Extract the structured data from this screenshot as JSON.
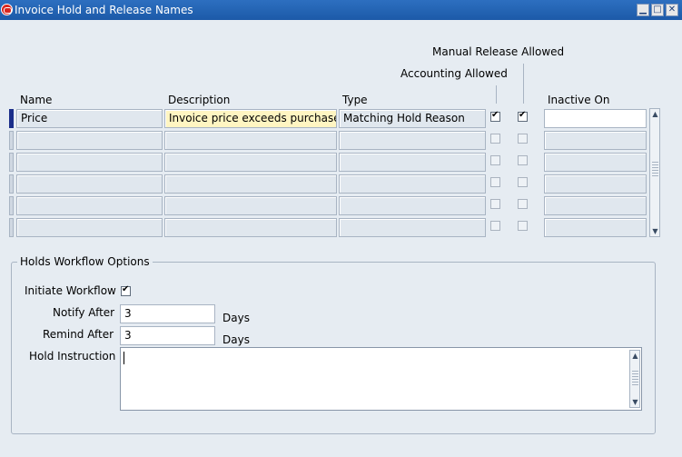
{
  "window": {
    "title": "Invoice Hold and Release Names",
    "controls": [
      "minimize",
      "maximize",
      "close"
    ]
  },
  "table": {
    "headers": {
      "name": "Name",
      "description": "Description",
      "type": "Type",
      "accounting_allowed": "Accounting Allowed",
      "manual_release_allowed": "Manual Release Allowed",
      "inactive_on": "Inactive On"
    },
    "rows": [
      {
        "name": "Price",
        "description": "Invoice price exceeds purchase o",
        "type": "Matching Hold Reason",
        "accounting_allowed": true,
        "manual_release_allowed": true,
        "inactive_on": ""
      },
      {
        "name": "",
        "description": "",
        "type": "",
        "accounting_allowed": false,
        "manual_release_allowed": false,
        "inactive_on": ""
      },
      {
        "name": "",
        "description": "",
        "type": "",
        "accounting_allowed": false,
        "manual_release_allowed": false,
        "inactive_on": ""
      },
      {
        "name": "",
        "description": "",
        "type": "",
        "accounting_allowed": false,
        "manual_release_allowed": false,
        "inactive_on": ""
      },
      {
        "name": "",
        "description": "",
        "type": "",
        "accounting_allowed": false,
        "manual_release_allowed": false,
        "inactive_on": ""
      },
      {
        "name": "",
        "description": "",
        "type": "",
        "accounting_allowed": false,
        "manual_release_allowed": false,
        "inactive_on": ""
      }
    ]
  },
  "workflow": {
    "title": "Holds Workflow Options",
    "initiate_label": "Initiate Workflow",
    "initiate_checked": true,
    "notify_label": "Notify After",
    "notify_value": "3",
    "notify_unit": "Days",
    "remind_label": "Remind After",
    "remind_value": "3",
    "remind_unit": "Days",
    "instruction_label": "Hold Instruction",
    "instruction_value": ""
  }
}
